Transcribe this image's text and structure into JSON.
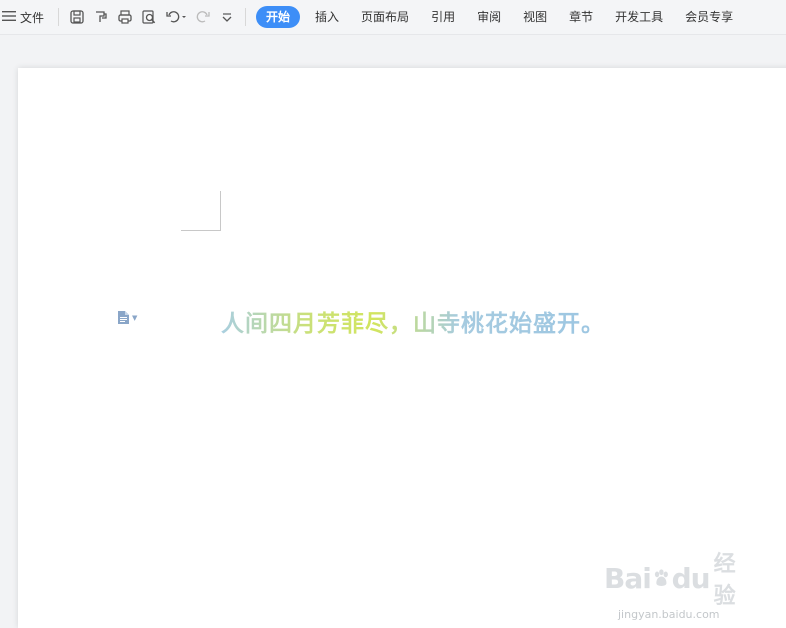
{
  "toolbar": {
    "file_label": "文件",
    "quick_icons": [
      "save-icon",
      "format-painter-icon",
      "print-icon",
      "print-preview-icon",
      "undo-icon",
      "redo-icon",
      "more-dropdown-icon"
    ],
    "tabs": [
      {
        "label": "开始",
        "active": true
      },
      {
        "label": "插入"
      },
      {
        "label": "页面布局"
      },
      {
        "label": "引用"
      },
      {
        "label": "审阅"
      },
      {
        "label": "视图"
      },
      {
        "label": "章节"
      },
      {
        "label": "开发工具"
      },
      {
        "label": "会员专享"
      }
    ],
    "accent_color": "#3d8ef7"
  },
  "document": {
    "text": "人间四月芳菲尽，山寺桃花始盛开。"
  },
  "watermark": {
    "brand": "Bai du 经验",
    "url": "jingyan.baidu.com"
  }
}
